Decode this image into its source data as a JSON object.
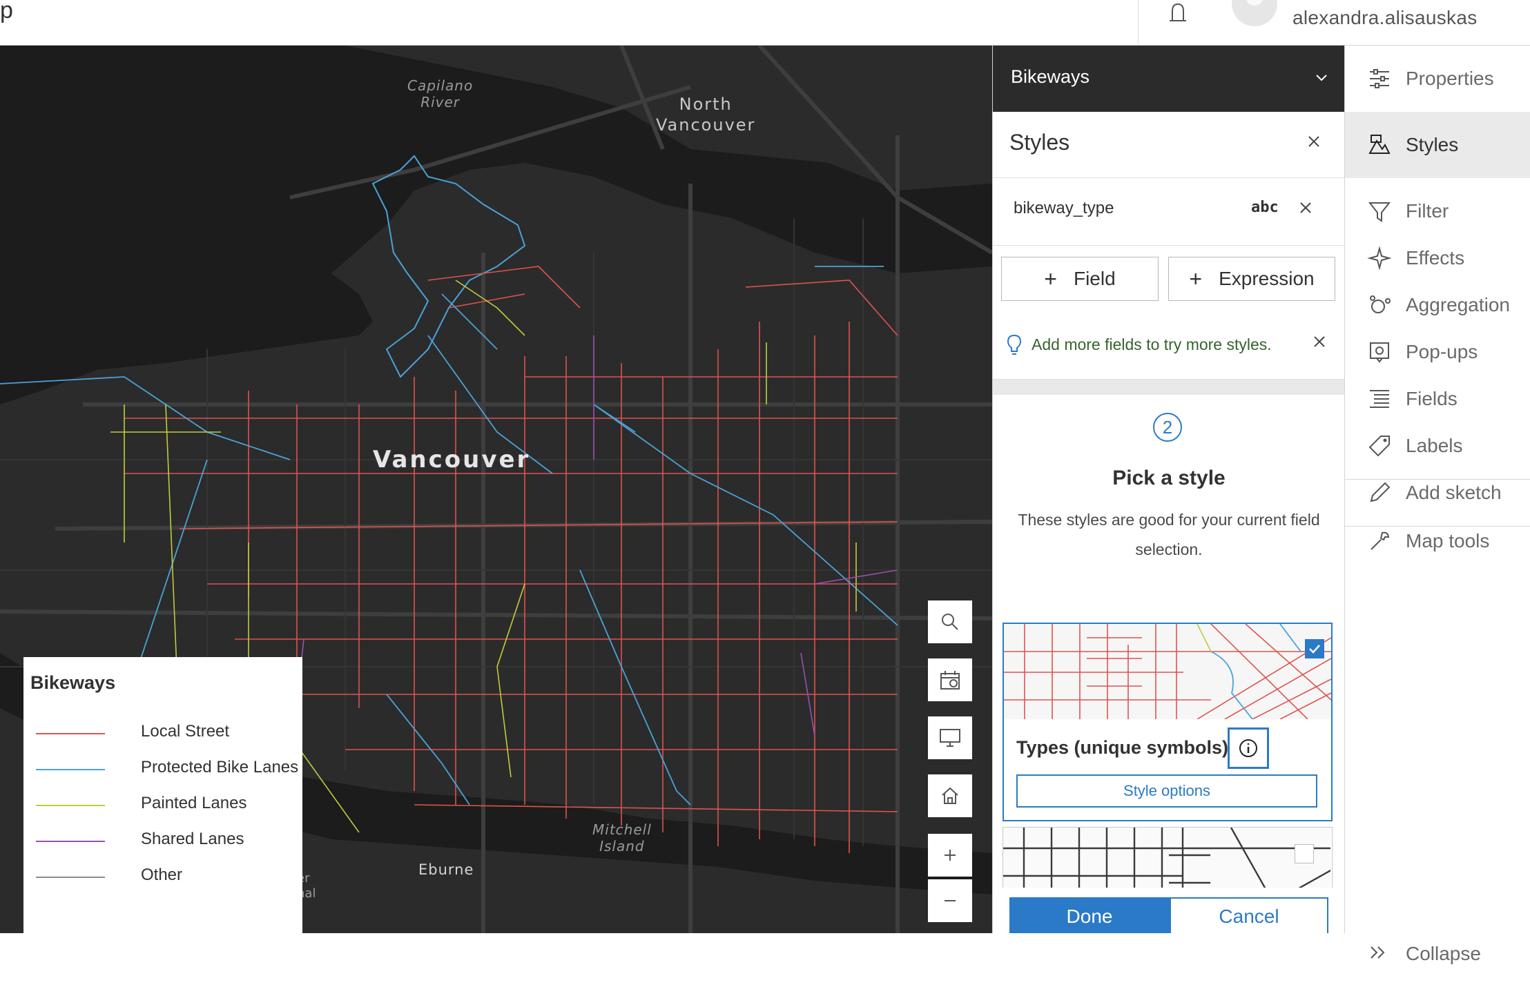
{
  "header": {
    "app_fragment": "p",
    "username": "alexandra.alisauskas"
  },
  "map": {
    "labels": {
      "capilano": "Capilano\nRiver",
      "north_vancouver": "North\nVancouver",
      "vancouver": "Vancouver",
      "mitchell_island": "Mitchell\nIsland",
      "eburne": "Eburne",
      "terminal": "er\nnal"
    },
    "tools": [
      "search-icon",
      "basemap-icon",
      "fullscreen-icon",
      "home-icon",
      "zoom-in-icon",
      "zoom-out-icon"
    ]
  },
  "legend": {
    "title": "Bikeways",
    "items": [
      {
        "label": "Local Street",
        "color": "#e0534e"
      },
      {
        "label": "Protected Bike Lanes",
        "color": "#4aa3d8"
      },
      {
        "label": "Painted Lanes",
        "color": "#c2cc3b"
      },
      {
        "label": "Shared Lanes",
        "color": "#9b4fb4"
      },
      {
        "label": "Other",
        "color": "#8c8c8c"
      }
    ]
  },
  "panel": {
    "layer_name": "Bikeways",
    "title": "Styles",
    "field_name": "bikeway_type",
    "field_type_glyph": "abc",
    "add_field_label": "Field",
    "add_expression_label": "Expression",
    "notice": "Add more fields to try more styles.",
    "step_number": "2",
    "pick_heading": "Pick a style",
    "pick_sub": "These styles are good for your current field selection.",
    "selected_style": {
      "title": "Types (unique symbols)",
      "options_label": "Style options",
      "checked": true
    },
    "second_style": {
      "checked": false
    },
    "done_label": "Done",
    "cancel_label": "Cancel"
  },
  "actions": [
    {
      "label": "Properties",
      "icon": "properties-icon",
      "active": false
    },
    {
      "label": "Styles",
      "icon": "styles-icon",
      "active": true
    },
    {
      "label": "Filter",
      "icon": "filter-icon",
      "active": false
    },
    {
      "label": "Effects",
      "icon": "effects-icon",
      "active": false
    },
    {
      "label": "Aggregation",
      "icon": "aggregation-icon",
      "active": false
    },
    {
      "label": "Pop-ups",
      "icon": "popups-icon",
      "active": false
    },
    {
      "label": "Fields",
      "icon": "fields-icon",
      "active": false
    },
    {
      "label": "Labels",
      "icon": "labels-icon",
      "active": false
    },
    {
      "label": "Add sketch",
      "icon": "sketch-icon",
      "active": false
    },
    {
      "label": "Map tools",
      "icon": "map-tools-icon",
      "active": false
    },
    {
      "label": "Collapse",
      "icon": "collapse-icon",
      "active": false
    }
  ],
  "colors": {
    "accent": "#2b7ac8",
    "map_background": "#2b2b2b",
    "water": "#1c1c1c",
    "notice_text": "#35652b"
  }
}
